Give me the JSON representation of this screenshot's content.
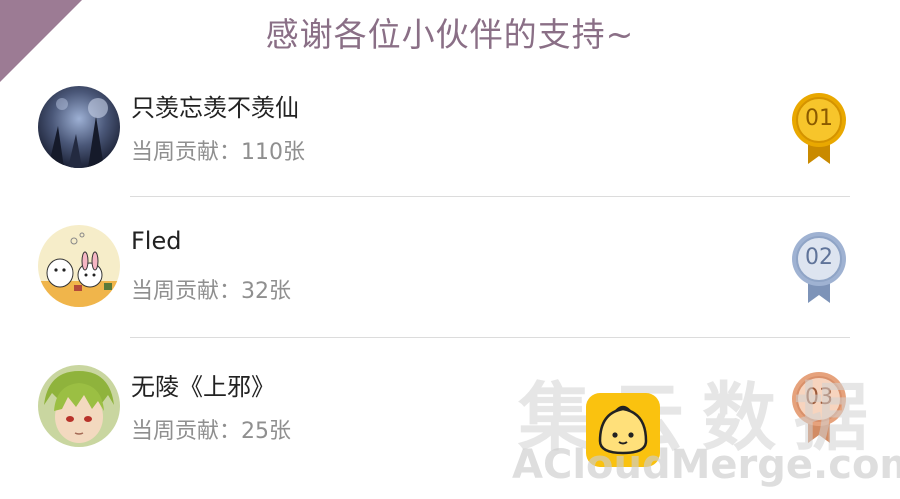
{
  "title": "感谢各位小伙伴的支持~",
  "supporters": [
    {
      "name": "只羡忘羡不羡仙",
      "contribution": "当周贡献：110张",
      "rank": "01",
      "badge_color": "#e6a400",
      "avatar": "dark-forest-avatar"
    },
    {
      "name": "Fled",
      "contribution": "当周贡献：32张",
      "rank": "02",
      "badge_color": "#8fa4c6",
      "avatar": "cartoon-characters-avatar"
    },
    {
      "name": "无陵《上邪》",
      "contribution": "当周贡献：25张",
      "rank": "03",
      "badge_color": "#e6a27c",
      "avatar": "green-hair-anime-avatar"
    }
  ],
  "watermark": {
    "chinese": "集云数据",
    "latin": "ACloudMerge.com",
    "logo_icon": "bun-mascot-icon",
    "logo_color": "#fac20f"
  },
  "colors": {
    "title": "#8a6f86",
    "ribbon": "#9c7b94"
  }
}
